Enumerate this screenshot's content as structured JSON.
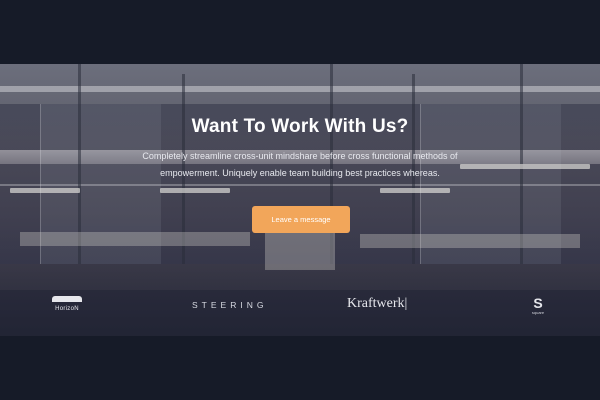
{
  "hero": {
    "title": "Want To Work With Us?",
    "subtitle": "Completely streamline cross-unit mindshare before cross functional methods of empowerment. Uniquely enable team building best practices whereas.",
    "cta_label": "Leave a message"
  },
  "logos": {
    "horizon": "HorizoN",
    "steering": "STEERING",
    "kraftwerk": "Kraftwerk",
    "square_mark": "S",
    "square_text": "square"
  },
  "colors": {
    "page_background": "#161b28",
    "cta_background": "#f2a65a",
    "text": "#ffffff"
  }
}
